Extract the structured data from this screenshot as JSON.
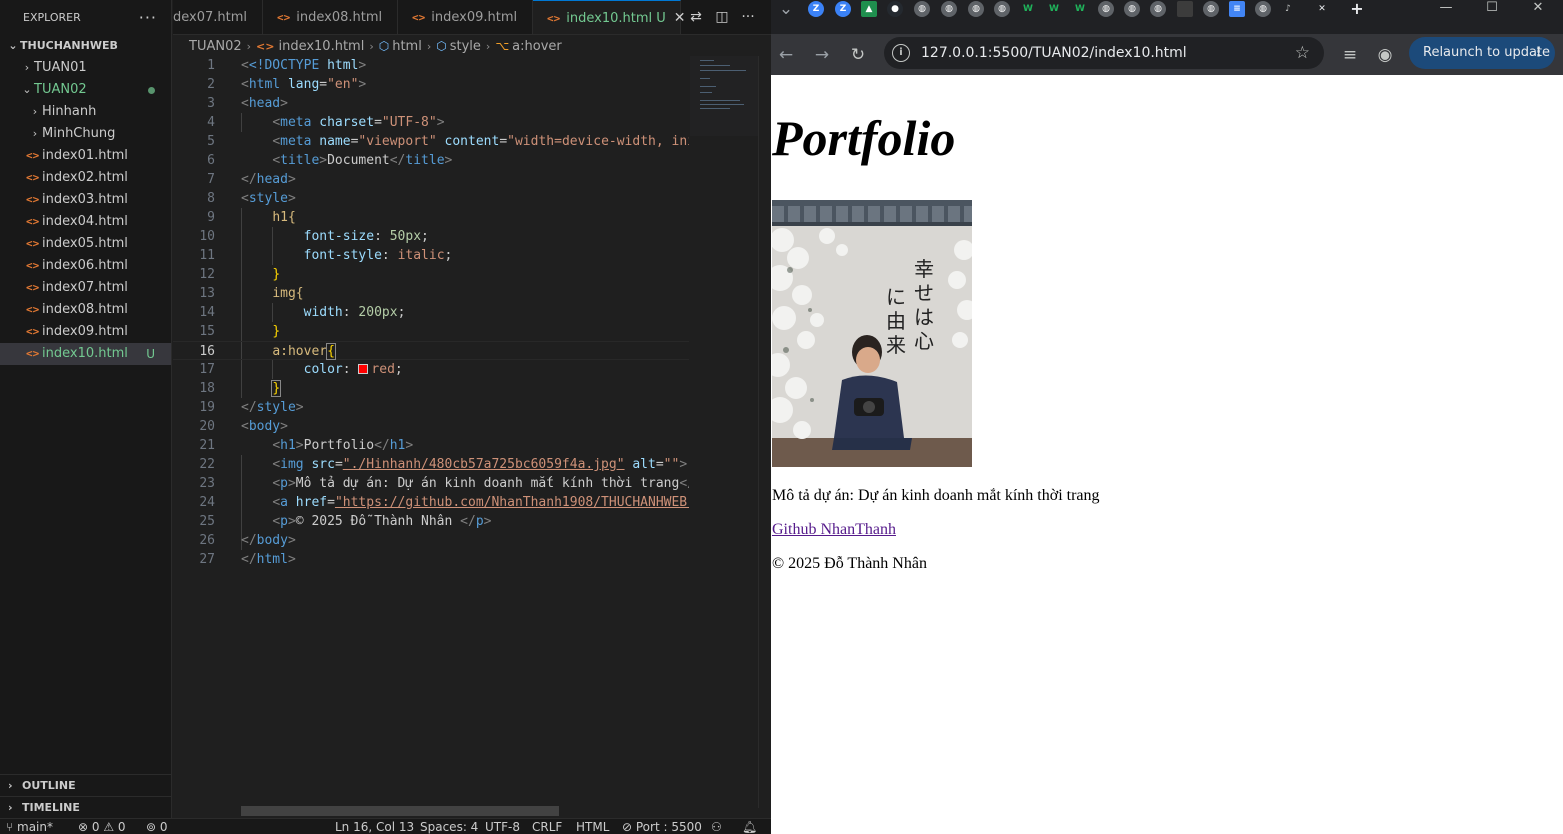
{
  "explorer": {
    "title": "EXPLORER",
    "more": "···",
    "root": "THUCHANHWEB",
    "folders": [
      {
        "label": "TUAN01"
      },
      {
        "label": "TUAN02"
      }
    ],
    "subfolders": [
      {
        "label": "Hinhanh"
      },
      {
        "label": "MinhChung"
      }
    ],
    "files": [
      {
        "label": "index01.html"
      },
      {
        "label": "index02.html"
      },
      {
        "label": "index03.html"
      },
      {
        "label": "index04.html"
      },
      {
        "label": "index05.html"
      },
      {
        "label": "index06.html"
      },
      {
        "label": "index07.html"
      },
      {
        "label": "index08.html"
      },
      {
        "label": "index09.html"
      },
      {
        "label": "index10.html",
        "badge": "U"
      }
    ],
    "outline": "OUTLINE",
    "timeline": "TIMELINE"
  },
  "editor": {
    "tabs": [
      {
        "label": "dex07.html"
      },
      {
        "label": "index08.html"
      },
      {
        "label": "index09.html"
      },
      {
        "label": "index10.html",
        "badge": "U"
      }
    ],
    "breadcrumb": {
      "folder": "TUAN02",
      "file": "index10.html",
      "n1": "html",
      "n2": "style",
      "n3": "a:hover"
    },
    "line_numbers": [
      "1",
      "2",
      "3",
      "4",
      "5",
      "6",
      "7",
      "8",
      "9",
      "10",
      "11",
      "12",
      "13",
      "14",
      "15",
      "16",
      "17",
      "18",
      "19",
      "20",
      "21",
      "22",
      "23",
      "24",
      "25",
      "26",
      "27"
    ],
    "code": {
      "doctype": "<!DOCTYPE",
      "html_kw": "html",
      "lang_val": "\"en\"",
      "charset_val": "\"UTF-8\"",
      "viewport_val": "\"viewport\"",
      "content_val": "\"width=device-width, init",
      "title_text": "Document",
      "h1_sel": "h1{",
      "fs_prop": "font-size",
      "fs_val": "50px",
      "fst_prop": "font-style",
      "fst_val": "italic",
      "img_sel": "img{",
      "w_prop": "width",
      "w_val": "200px",
      "hover_sel": "a:hover",
      "color_prop": "color",
      "color_val": "red",
      "h1_text": "Portfolio",
      "src_val": "\"./Hinhanh/480cb57a725bc6059f4a.jpg\"",
      "alt_val": "\"\"",
      "p1_text": "Mô tả dự án: Dự án kinh doanh mắt kính thời trang",
      "href_val": "\"https://github.com/NhanThanh1908/THUCHANHWEB\"",
      "p2_text": "© 2025 Đỗ Thành Nhân "
    }
  },
  "statusbar": {
    "branch": "main*",
    "problems": "⊗ 0 ⚠ 0",
    "ports": "0",
    "position": "Ln 16, Col 13",
    "spaces": "Spaces: 4",
    "encoding": "UTF-8",
    "eol": "CRLF",
    "language": "HTML",
    "port": "Port : 5500"
  },
  "browser": {
    "url": "127.0.0.1:5500/TUAN02/index10.html",
    "relaunch": "Relaunch to update",
    "page": {
      "heading": "Portfolio",
      "description": "Mô tả dự án: Dự án kinh doanh mắt kính thời trang",
      "link": "Github NhanThanh",
      "copyright": "© 2025 Đỗ Thành Nhân",
      "photo_text": "幸せは心に由来す"
    }
  }
}
